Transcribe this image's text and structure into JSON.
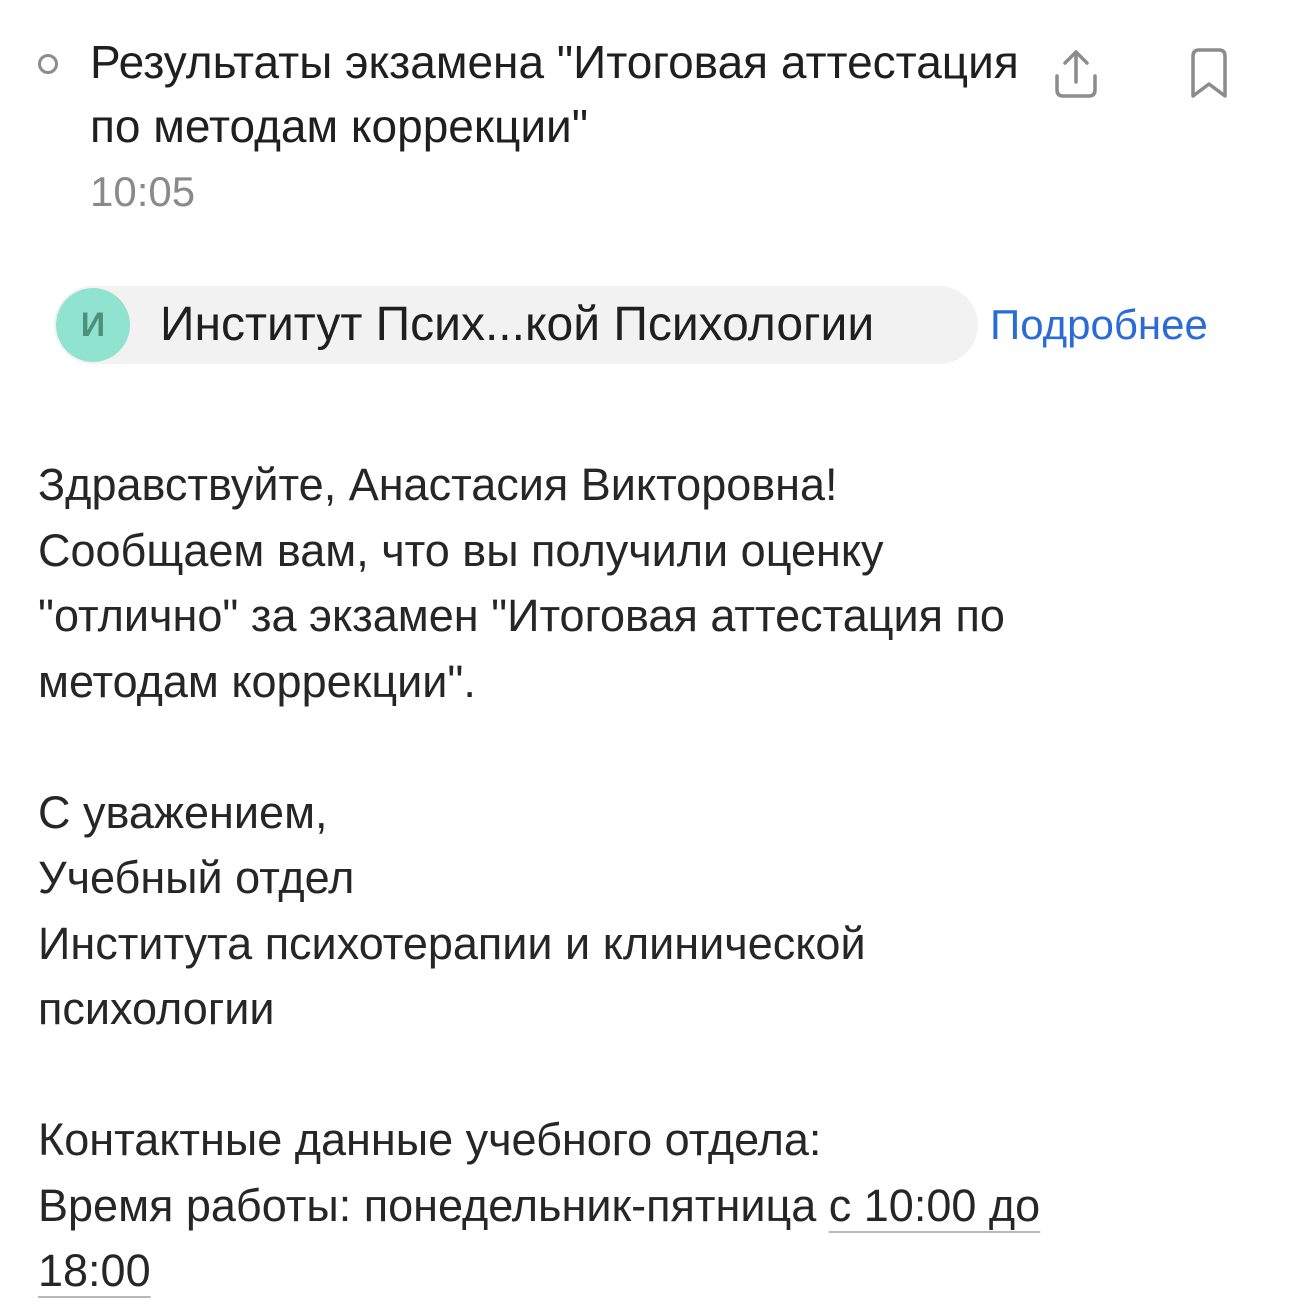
{
  "message": {
    "subject": "Результаты экзамена \"Итоговая аттестация по методам коррекции\"",
    "time": "10:05"
  },
  "icons": {
    "unread": "unread-dot-icon",
    "share": "share-icon",
    "bookmark": "bookmark-icon"
  },
  "sender": {
    "avatar_letter": "И",
    "name": "Институт Псих...кой Психологии",
    "details_label": "Подробнее"
  },
  "body": {
    "greeting": "Здравствуйте, Анастасия Викторовна!",
    "line1": "Сообщаем вам, что вы получили оценку",
    "line2": "\"отлично\" за  экзамен \"Итоговая аттестация по",
    "line3": "методам коррекции\".",
    "closing": "С уважением,",
    "signature1": "Учебный отдел",
    "signature2": "Института психотерапии и клинической",
    "signature3": "психологии",
    "contacts_heading": "Контактные данные учебного отдела:",
    "hours_prefix": "Время работы: понедельник-пятница ",
    "hours_link_part1": "с 10:00 до",
    "hours_link_part2": "18:00"
  },
  "colors": {
    "link": "#2a6bd6",
    "avatar_bg": "#8fe3cf",
    "avatar_text": "#4f8f7c",
    "chip_bg": "#f2f2f2",
    "secondary_text": "#8a8a8a"
  }
}
